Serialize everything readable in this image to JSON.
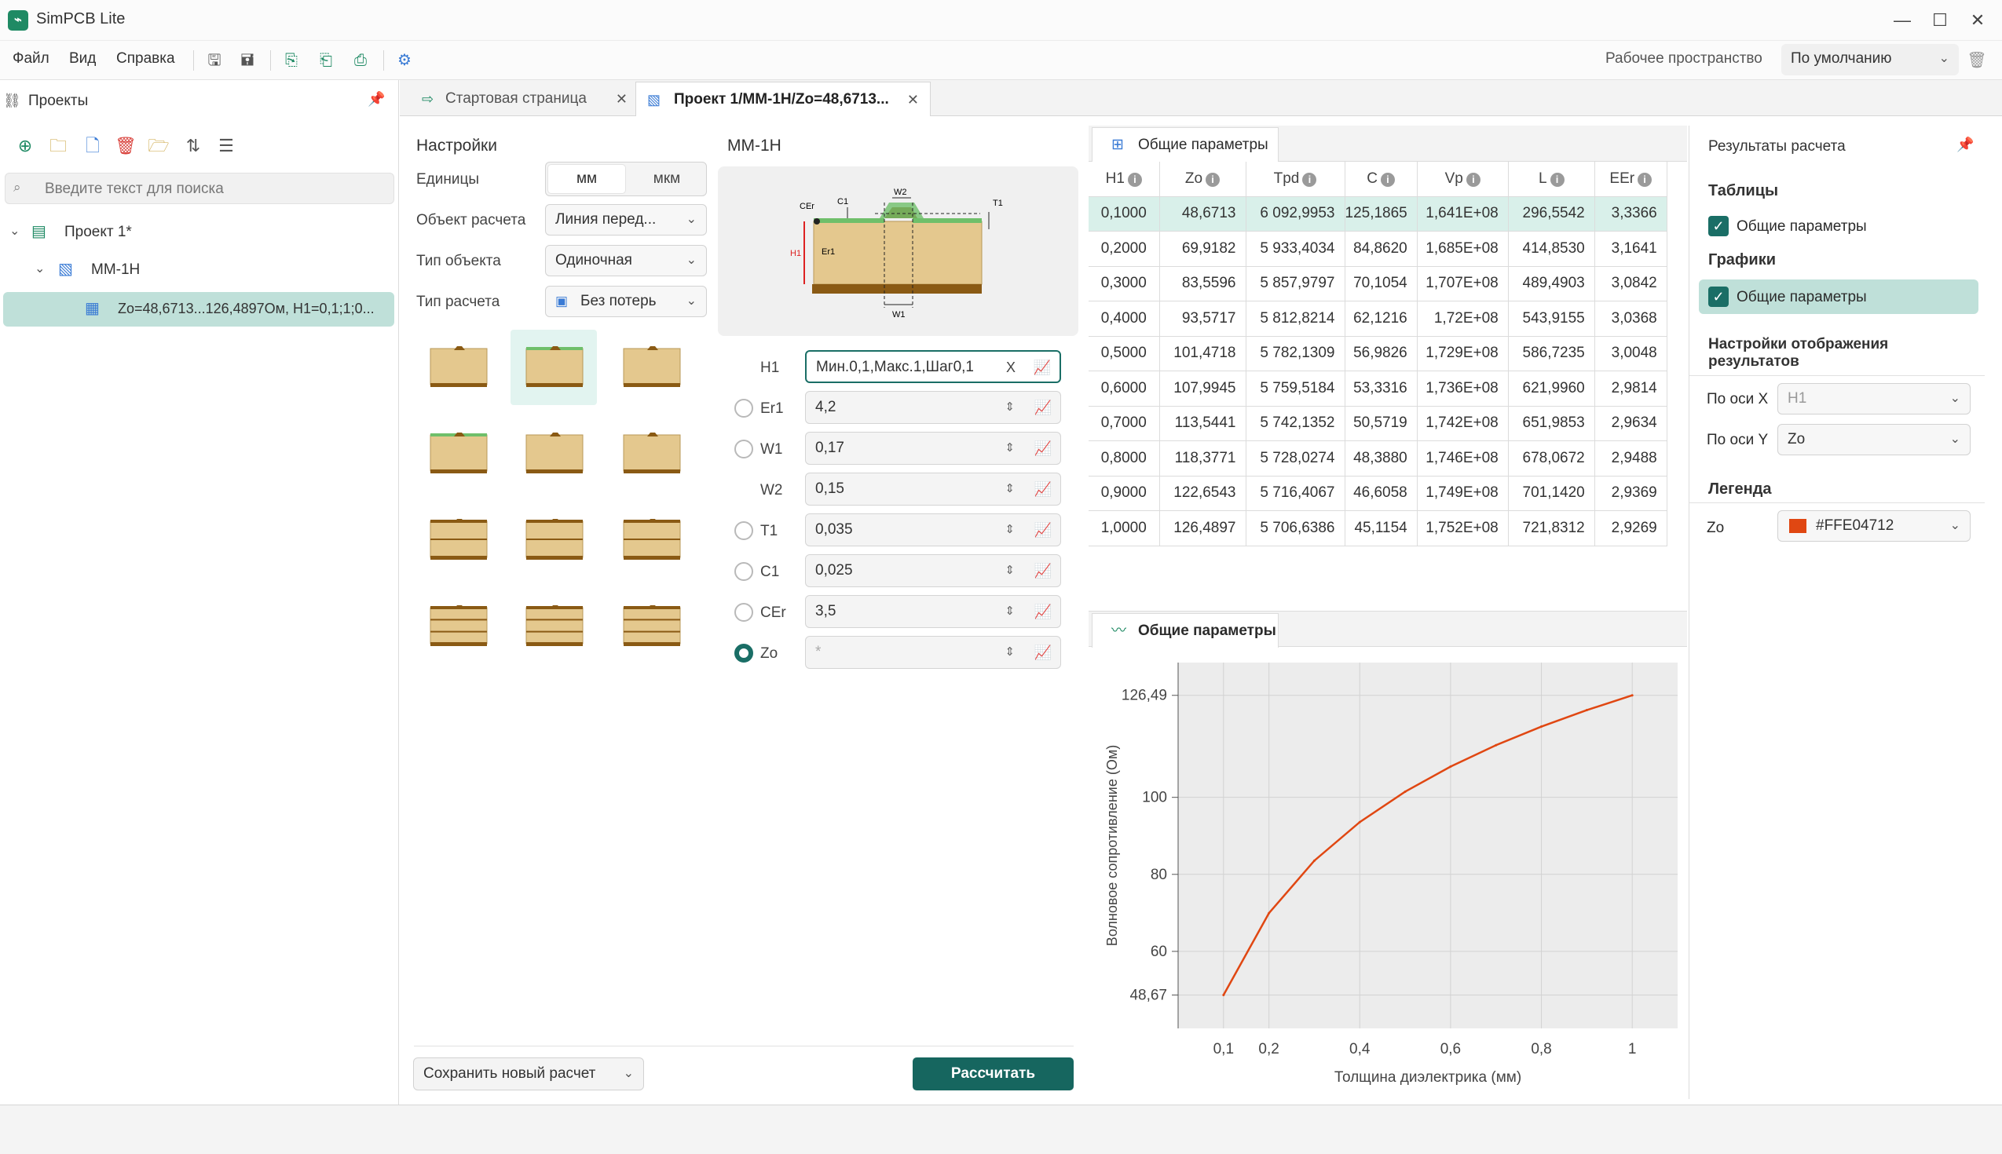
{
  "app": {
    "title": "SimPCB Lite"
  },
  "menu": {
    "items": [
      "Файл",
      "Вид",
      "Справка"
    ]
  },
  "workspace": {
    "label": "Рабочее пространство",
    "value": "По умолчанию"
  },
  "projects_panel": {
    "title": "Проекты",
    "search_placeholder": "Введите текст для поиска",
    "tree": [
      {
        "label": "Проект 1*"
      },
      {
        "label": "MM-1H"
      },
      {
        "label": "Zo=48,6713...126,4897Ом, H1=0,1;1;0..."
      }
    ]
  },
  "tabs": [
    {
      "label": "Стартовая страница"
    },
    {
      "label": "Проект 1/MM-1H/Zo=48,6713..."
    }
  ],
  "settings": {
    "title": "Настройки",
    "units_label": "Единицы",
    "units_options": [
      "мм",
      "мкм"
    ],
    "object_label": "Объект расчета",
    "object_value": "Линия перед...",
    "type_label": "Тип объекта",
    "type_value": "Одиночная",
    "calc_label": "Тип расчета",
    "calc_value": "Без потерь",
    "save_button": "Сохранить новый расчет"
  },
  "model": {
    "title": "MM-1H",
    "diagram_labels": {
      "cer": "CEr",
      "c1": "C1",
      "w2": "W2",
      "t1": "T1",
      "h1": "H1",
      "er1": "Er1",
      "w1": "W1"
    },
    "params": [
      {
        "name": "H1",
        "value": "Мин.0,1,Макс.1,Шаг0,1"
      },
      {
        "name": "Er1",
        "value": "4,2"
      },
      {
        "name": "W1",
        "value": "0,17"
      },
      {
        "name": "W2",
        "value": "0,15"
      },
      {
        "name": "T1",
        "value": "0,035"
      },
      {
        "name": "C1",
        "value": "0,025"
      },
      {
        "name": "CEr",
        "value": "3,5"
      },
      {
        "name": "Zo",
        "value": "*"
      }
    ],
    "calc_button": "Рассчитать"
  },
  "table": {
    "tab_label": "Общие параметры",
    "columns": [
      "H1",
      "Zo",
      "Tpd",
      "C",
      "Vp",
      "L",
      "EEr"
    ],
    "rows": [
      [
        "0,1000",
        "48,6713",
        "6 092,9953",
        "125,1865",
        "1,641E+08",
        "296,5542",
        "3,3366"
      ],
      [
        "0,2000",
        "69,9182",
        "5 933,4034",
        "84,8620",
        "1,685E+08",
        "414,8530",
        "3,1641"
      ],
      [
        "0,3000",
        "83,5596",
        "5 857,9797",
        "70,1054",
        "1,707E+08",
        "489,4903",
        "3,0842"
      ],
      [
        "0,4000",
        "93,5717",
        "5 812,8214",
        "62,1216",
        "1,72E+08",
        "543,9155",
        "3,0368"
      ],
      [
        "0,5000",
        "101,4718",
        "5 782,1309",
        "56,9826",
        "1,729E+08",
        "586,7235",
        "3,0048"
      ],
      [
        "0,6000",
        "107,9945",
        "5 759,5184",
        "53,3316",
        "1,736E+08",
        "621,9960",
        "2,9814"
      ],
      [
        "0,7000",
        "113,5441",
        "5 742,1352",
        "50,5719",
        "1,742E+08",
        "651,9853",
        "2,9634"
      ],
      [
        "0,8000",
        "118,3771",
        "5 728,0274",
        "48,3880",
        "1,746E+08",
        "678,0672",
        "2,9488"
      ],
      [
        "0,9000",
        "122,6543",
        "5 716,4067",
        "46,6058",
        "1,749E+08",
        "701,1420",
        "2,9369"
      ],
      [
        "1,0000",
        "126,4897",
        "5 706,6386",
        "45,1154",
        "1,752E+08",
        "721,8312",
        "2,9269"
      ]
    ]
  },
  "chart_tab_label": "Общие параметры",
  "chart_data": {
    "type": "line",
    "title": "",
    "xlabel": "Толщина диэлектрика (мм)",
    "ylabel": "Волновое сопротивление (Ом)",
    "x": [
      0.1,
      0.2,
      0.3,
      0.4,
      0.5,
      0.6,
      0.7,
      0.8,
      0.9,
      1.0
    ],
    "series": [
      {
        "name": "Zo",
        "values": [
          48.6713,
          69.9182,
          83.5596,
          93.5717,
          101.4718,
          107.9945,
          113.5441,
          118.3771,
          122.6543,
          126.4897
        ],
        "color": "#FFE04712"
      }
    ],
    "x_ticks": [
      "0,1",
      "0,2",
      "0,4",
      "0,6",
      "0,8",
      "1"
    ],
    "x_tick_values": [
      0.1,
      0.2,
      0.4,
      0.6,
      0.8,
      1.0
    ],
    "y_ticks": [
      "48,67",
      "60",
      "80",
      "100",
      "126,49"
    ],
    "y_tick_values": [
      48.67,
      60,
      80,
      100,
      126.49
    ],
    "xlim": [
      0,
      1.1
    ],
    "ylim": [
      40,
      135
    ],
    "grid": true
  },
  "results_panel": {
    "title": "Результаты расчета",
    "tables_heading": "Таблицы",
    "tables_item": "Общие параметры",
    "charts_heading": "Графики",
    "charts_item": "Общие параметры",
    "display_heading": "Настройки отображения результатов",
    "x_axis_label": "По оси X",
    "x_axis_value": "H1",
    "y_axis_label": "По оси Y",
    "y_axis_value": "Zo",
    "legend_heading": "Легенда",
    "legend_series": "Zo",
    "legend_color_text": "#FFE04712",
    "legend_swatch": "#E04712"
  }
}
